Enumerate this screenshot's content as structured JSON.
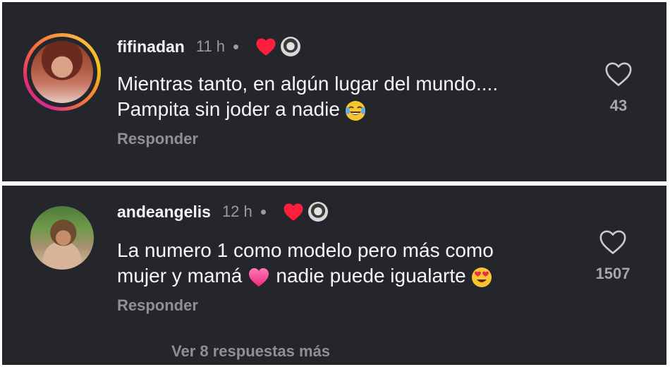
{
  "comments": [
    {
      "username": "fifinadan",
      "time": "11 h",
      "text_lines": [
        "Mientras tanto, en algún lugar del mundo....",
        "Pampita sin joder a nadie"
      ],
      "text_emoji": "tears-of-joy-emoji",
      "reply_label": "Responder",
      "likes": "43",
      "liked_by_creator": true
    },
    {
      "username": "andeangelis",
      "time": "12 h",
      "text_lines": [
        "La numero 1 como modelo pero más como",
        "mujer y mamá",
        "nadie puede igualarte"
      ],
      "text_emoji": "heart-eyes-emoji",
      "reply_label": "Responder",
      "likes": "1507",
      "liked_by_creator": true,
      "view_replies_label": "Ver 8 respuestas más"
    }
  ],
  "colors": {
    "background": "#25262c",
    "text": "#f5f5f5",
    "muted": "#8f9096",
    "heart_red": "#ff1f3d",
    "story_ring": "#e1306c"
  },
  "icons": {
    "like": "heart-outline-icon",
    "creator_like": "heart-filled-icon"
  }
}
